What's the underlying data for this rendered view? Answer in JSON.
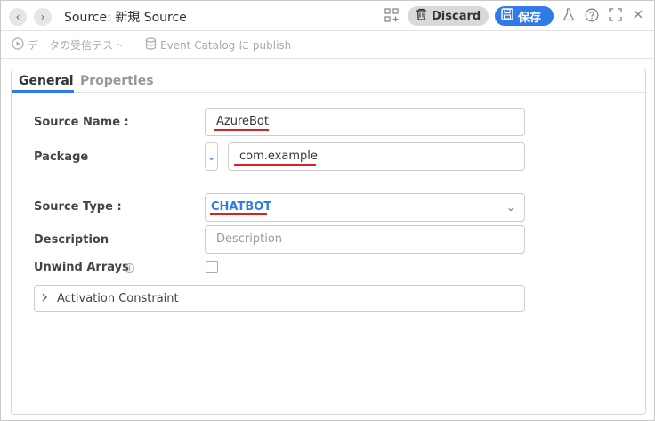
{
  "titlebar": {
    "title": "Source: 新規 Source",
    "discard_label": "Discard",
    "save_label": "保存"
  },
  "toolbar": {
    "test_label": "データの受信テスト",
    "publish_label": "Event Catalog に publish"
  },
  "tabs": [
    {
      "label": "General",
      "active": true
    },
    {
      "label": "Properties",
      "active": false
    }
  ],
  "form": {
    "source_name_label": "Source Name :",
    "source_name_value": "AzureBot",
    "package_label": "Package",
    "package_value": "com.example",
    "source_type_label": "Source Type :",
    "source_type_value": "CHATBOT",
    "description_label": "Description",
    "description_placeholder": "Description",
    "unwind_arrays_label": "Unwind Arrays",
    "unwind_arrays_checked": false,
    "activation_constraint_label": "Activation Constraint"
  },
  "colors": {
    "accent": "#2f7be8",
    "highlight_underline": "#e02020",
    "discard_bg": "#d9d9d9"
  },
  "icons": [
    "back-icon",
    "forward-icon",
    "grid-add-icon",
    "trash-icon",
    "floppy-icon",
    "flask-icon",
    "help-icon",
    "fullscreen-icon",
    "close-icon",
    "play-circle-icon",
    "database-icon",
    "info-icon",
    "chevron-down-icon",
    "chevron-right-icon"
  ]
}
